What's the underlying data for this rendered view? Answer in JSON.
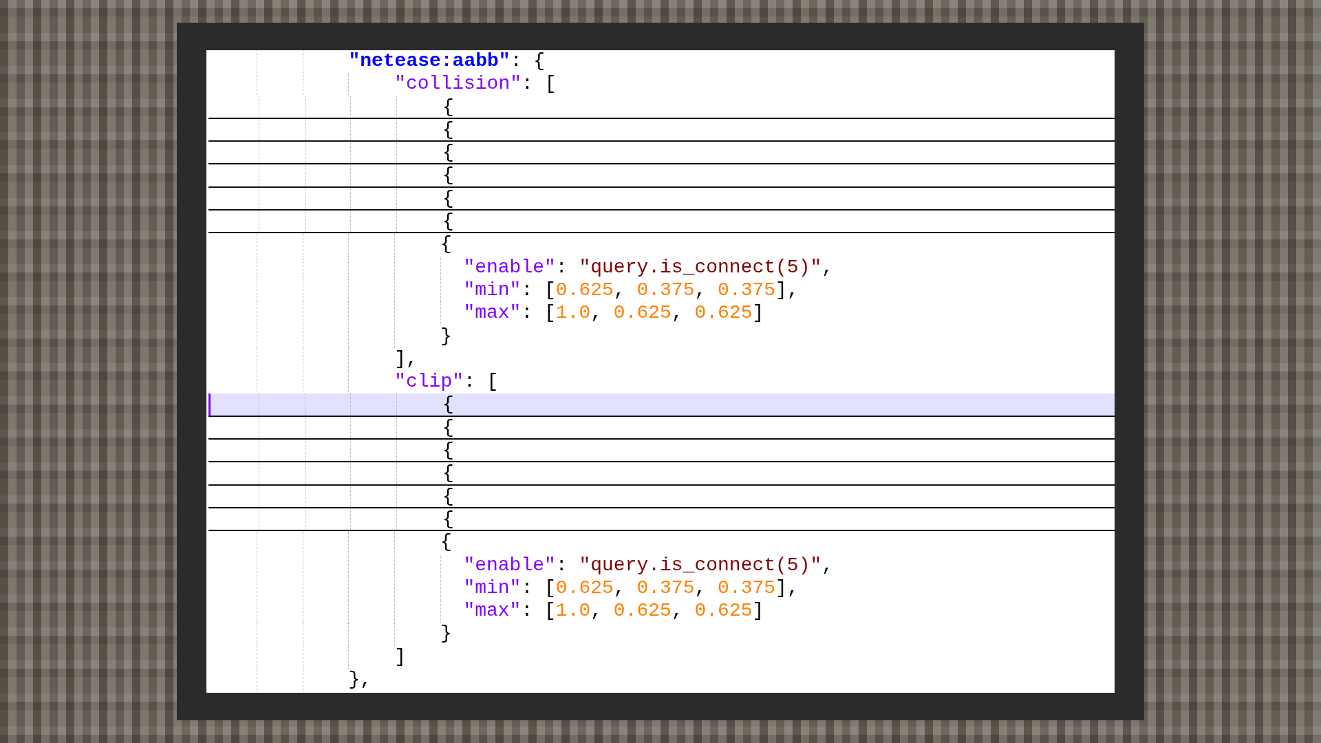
{
  "editor": {
    "lines": [
      {
        "folded": false,
        "current": false,
        "tokens": [
          {
            "kind": "root_key",
            "text": "\"netease:aabb\""
          },
          {
            "kind": "punct",
            "text": ": {"
          }
        ],
        "children": [
          {
            "folded": false,
            "current": false,
            "tokens": [
              {
                "kind": "key",
                "text": "\"collision\""
              },
              {
                "kind": "punct",
                "text": ": ["
              }
            ],
            "children": [
              {
                "folded": true,
                "current": false,
                "tokens": [
                  {
                    "kind": "punct",
                    "text": "{"
                  }
                ]
              },
              {
                "folded": true,
                "current": false,
                "tokens": [
                  {
                    "kind": "punct",
                    "text": "{"
                  }
                ]
              },
              {
                "folded": true,
                "current": false,
                "tokens": [
                  {
                    "kind": "punct",
                    "text": "{"
                  }
                ]
              },
              {
                "folded": true,
                "current": false,
                "tokens": [
                  {
                    "kind": "punct",
                    "text": "{"
                  }
                ]
              },
              {
                "folded": true,
                "current": false,
                "tokens": [
                  {
                    "kind": "punct",
                    "text": "{"
                  }
                ]
              },
              {
                "folded": true,
                "current": false,
                "tokens": [
                  {
                    "kind": "punct",
                    "text": "{"
                  }
                ]
              },
              {
                "folded": false,
                "current": false,
                "tokens": [
                  {
                    "kind": "punct",
                    "text": "{"
                  }
                ],
                "children": [
                  {
                    "folded": false,
                    "current": false,
                    "tokens": [
                      {
                        "kind": "key",
                        "text": "\"enable\""
                      },
                      {
                        "kind": "punct",
                        "text": ": "
                      },
                      {
                        "kind": "string",
                        "text": "\"query.is_connect(5)\""
                      },
                      {
                        "kind": "punct",
                        "text": ","
                      }
                    ]
                  },
                  {
                    "folded": false,
                    "current": false,
                    "tokens": [
                      {
                        "kind": "key",
                        "text": "\"min\""
                      },
                      {
                        "kind": "punct",
                        "text": ": ["
                      },
                      {
                        "kind": "number",
                        "text": "0.625"
                      },
                      {
                        "kind": "punct",
                        "text": ", "
                      },
                      {
                        "kind": "number",
                        "text": "0.375"
                      },
                      {
                        "kind": "punct",
                        "text": ", "
                      },
                      {
                        "kind": "number",
                        "text": "0.375"
                      },
                      {
                        "kind": "punct",
                        "text": "],"
                      }
                    ]
                  },
                  {
                    "folded": false,
                    "current": false,
                    "tokens": [
                      {
                        "kind": "key",
                        "text": "\"max\""
                      },
                      {
                        "kind": "punct",
                        "text": ": ["
                      },
                      {
                        "kind": "number",
                        "text": "1.0"
                      },
                      {
                        "kind": "punct",
                        "text": ", "
                      },
                      {
                        "kind": "number",
                        "text": "0.625"
                      },
                      {
                        "kind": "punct",
                        "text": ", "
                      },
                      {
                        "kind": "number",
                        "text": "0.625"
                      },
                      {
                        "kind": "punct",
                        "text": "]"
                      }
                    ]
                  }
                ]
              },
              {
                "folded": false,
                "current": false,
                "tokens": [
                  {
                    "kind": "punct",
                    "text": "}"
                  }
                ]
              }
            ]
          },
          {
            "folded": false,
            "current": false,
            "tokens": [
              {
                "kind": "punct",
                "text": "],"
              }
            ]
          },
          {
            "folded": false,
            "current": false,
            "tokens": [
              {
                "kind": "key",
                "text": "\"clip\""
              },
              {
                "kind": "punct",
                "text": ": ["
              }
            ],
            "children": [
              {
                "folded": true,
                "current": true,
                "tokens": [
                  {
                    "kind": "punct",
                    "text": "{"
                  }
                ]
              },
              {
                "folded": true,
                "current": false,
                "tokens": [
                  {
                    "kind": "punct",
                    "text": "{"
                  }
                ]
              },
              {
                "folded": true,
                "current": false,
                "tokens": [
                  {
                    "kind": "punct",
                    "text": "{"
                  }
                ]
              },
              {
                "folded": true,
                "current": false,
                "tokens": [
                  {
                    "kind": "punct",
                    "text": "{"
                  }
                ]
              },
              {
                "folded": true,
                "current": false,
                "tokens": [
                  {
                    "kind": "punct",
                    "text": "{"
                  }
                ]
              },
              {
                "folded": true,
                "current": false,
                "tokens": [
                  {
                    "kind": "punct",
                    "text": "{"
                  }
                ]
              },
              {
                "folded": false,
                "current": false,
                "tokens": [
                  {
                    "kind": "punct",
                    "text": "{"
                  }
                ],
                "children": [
                  {
                    "folded": false,
                    "current": false,
                    "tokens": [
                      {
                        "kind": "key",
                        "text": "\"enable\""
                      },
                      {
                        "kind": "punct",
                        "text": ": "
                      },
                      {
                        "kind": "string",
                        "text": "\"query.is_connect(5)\""
                      },
                      {
                        "kind": "punct",
                        "text": ","
                      }
                    ]
                  },
                  {
                    "folded": false,
                    "current": false,
                    "tokens": [
                      {
                        "kind": "key",
                        "text": "\"min\""
                      },
                      {
                        "kind": "punct",
                        "text": ": ["
                      },
                      {
                        "kind": "number",
                        "text": "0.625"
                      },
                      {
                        "kind": "punct",
                        "text": ", "
                      },
                      {
                        "kind": "number",
                        "text": "0.375"
                      },
                      {
                        "kind": "punct",
                        "text": ", "
                      },
                      {
                        "kind": "number",
                        "text": "0.375"
                      },
                      {
                        "kind": "punct",
                        "text": "],"
                      }
                    ]
                  },
                  {
                    "folded": false,
                    "current": false,
                    "tokens": [
                      {
                        "kind": "key",
                        "text": "\"max\""
                      },
                      {
                        "kind": "punct",
                        "text": ": ["
                      },
                      {
                        "kind": "number",
                        "text": "1.0"
                      },
                      {
                        "kind": "punct",
                        "text": ", "
                      },
                      {
                        "kind": "number",
                        "text": "0.625"
                      },
                      {
                        "kind": "punct",
                        "text": ", "
                      },
                      {
                        "kind": "number",
                        "text": "0.625"
                      },
                      {
                        "kind": "punct",
                        "text": "]"
                      }
                    ]
                  }
                ]
              },
              {
                "folded": false,
                "current": false,
                "tokens": [
                  {
                    "kind": "punct",
                    "text": "}"
                  }
                ]
              }
            ]
          },
          {
            "folded": false,
            "current": false,
            "tokens": [
              {
                "kind": "punct",
                "text": "]"
              }
            ]
          }
        ]
      },
      {
        "folded": false,
        "current": false,
        "tokens": [
          {
            "kind": "punct",
            "text": "},"
          }
        ]
      }
    ]
  }
}
